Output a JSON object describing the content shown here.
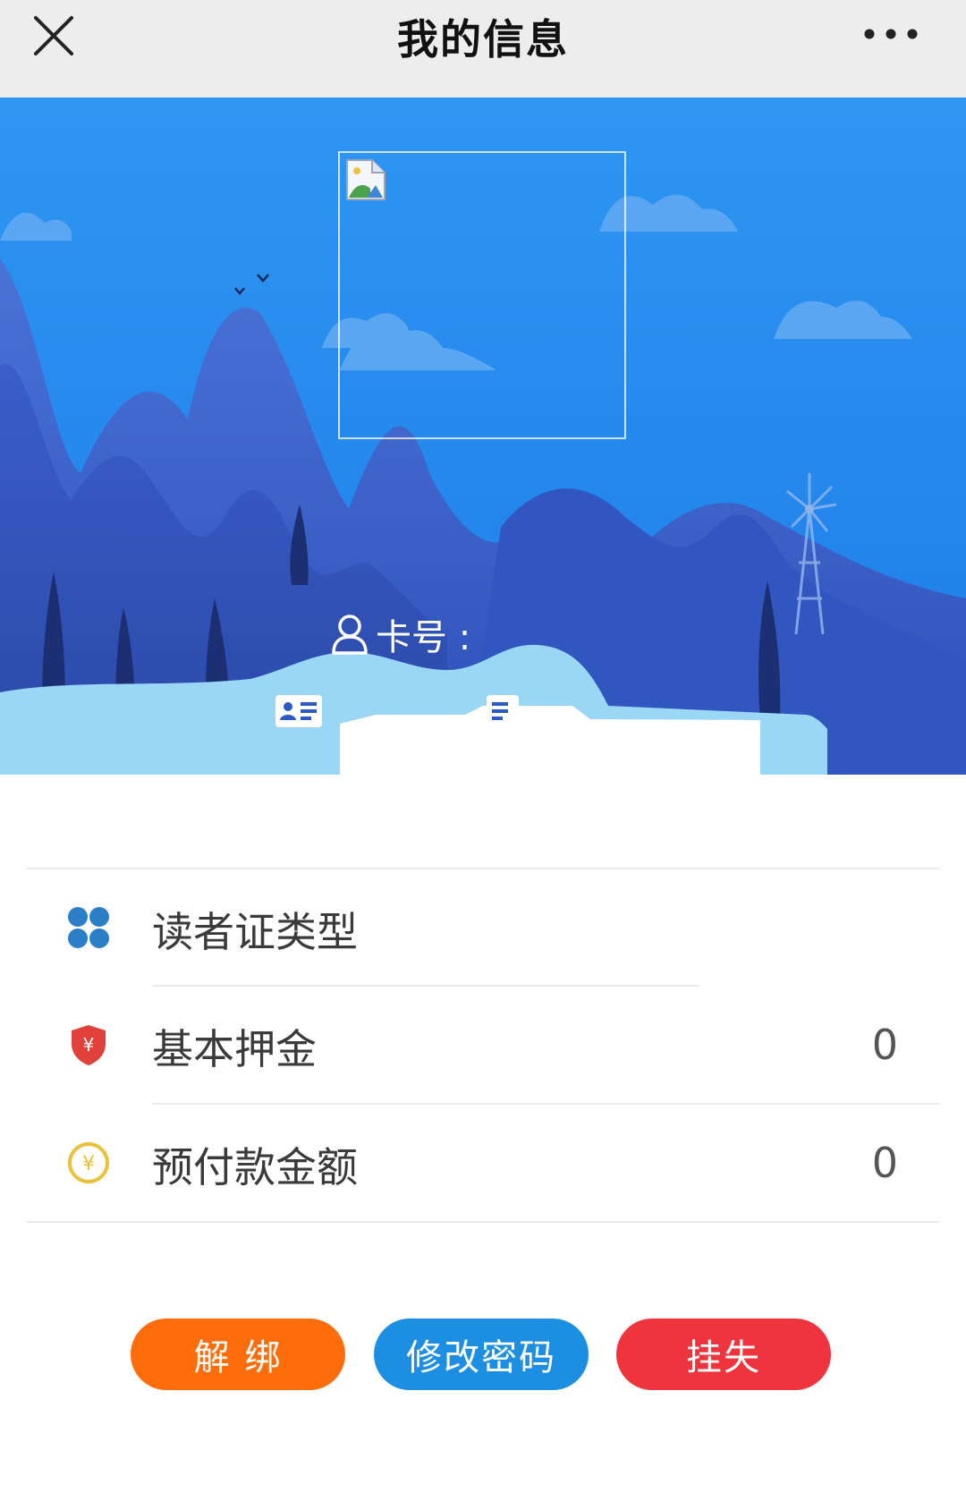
{
  "titlebar": {
    "title": "我的信息",
    "close_icon": "close-icon",
    "more_icon": "more-dots-icon"
  },
  "hero": {
    "card_label": "卡号 :"
  },
  "info": {
    "rows": [
      {
        "icon": "grid-icon",
        "label": "读者证类型",
        "value": ""
      },
      {
        "icon": "shield-yen-icon",
        "label": "基本押金",
        "value": "0"
      },
      {
        "icon": "yen-coin-icon",
        "label": "预付款金额",
        "value": "0"
      }
    ]
  },
  "buttons": {
    "unbind": "解 绑",
    "change_password": "修改密码",
    "report_loss": "挂失"
  },
  "colors": {
    "titlebar_bg": "#ededed",
    "hero_sky": "#2b8ff0",
    "unbind": "#fe6d0a",
    "change_password": "#1c8fe2",
    "report_loss": "#ef343e",
    "grid_icon": "#2a7fc6",
    "shield_icon": "#e0413a",
    "coin_icon": "#e9c23a"
  }
}
